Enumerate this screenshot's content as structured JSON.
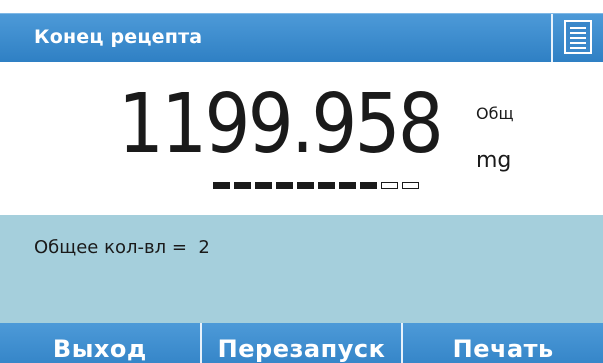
{
  "header": {
    "title": "Конец рецепта",
    "menu_icon": "document-list-icon"
  },
  "weight": {
    "value": "1199.958",
    "label": "Общ",
    "unit": "mg",
    "progress_total": 10,
    "progress_filled": 8
  },
  "info": {
    "total_count_text": "Общее кол-вл =  2"
  },
  "buttons": {
    "exit": "Выход",
    "restart": "Перезапуск",
    "print": "Печать"
  },
  "colors": {
    "accent": "#3a8bcf",
    "info_bg": "#a5cfdc",
    "text": "#1a1a1a"
  }
}
